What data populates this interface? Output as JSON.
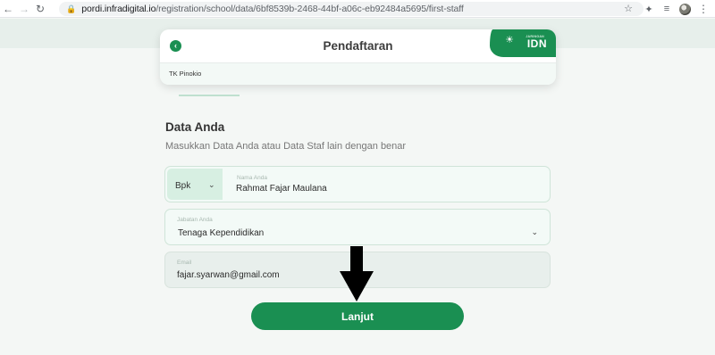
{
  "browser": {
    "url_domain": "pordi.infradigital.io",
    "url_path": "/registration/school/data/6bf8539b-2468-44bf-a06c-eb92484a5695/first-staff",
    "icons": [
      "back-icon",
      "forward-icon",
      "reload-icon",
      "lock-icon",
      "star-icon",
      "extensions-icon",
      "media-queue-icon",
      "avatar",
      "menu-icon"
    ]
  },
  "header": {
    "title": "Pendaftaran",
    "school_name": "TK Pinokio",
    "brand": {
      "small_text": "JARINGAN",
      "logo_text": "IDN"
    }
  },
  "form": {
    "section_title": "Data Anda",
    "section_subtitle": "Masukkan Data Anda atau Data Staf lain dengan benar",
    "name_prefix": "Bpk",
    "name_label": "Nama Anda",
    "name_value": "Rahmat Fajar Maulana",
    "job_label": "Jabatan Anda",
    "job_value": "Tenaga Kependidikan",
    "email_label": "Email",
    "email_value": "fajar.syarwan@gmail.com",
    "submit_label": "Lanjut"
  },
  "colors": {
    "primary": "#1a8f52",
    "field_bg": "#f3faf7",
    "page_bg": "#f4f7f5"
  }
}
